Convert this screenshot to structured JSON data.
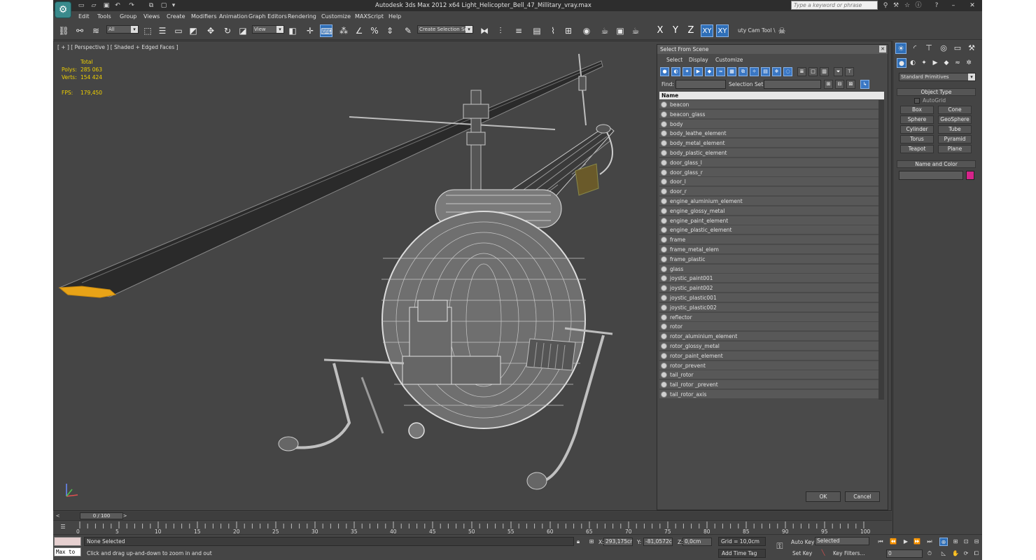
{
  "titlebar": {
    "app_title": "Autodesk 3ds Max  2012 x64     Light_Helicopter_Bell_47_Millitary_vray.max",
    "search_placeholder": "Type a keyword or phrase"
  },
  "menu": [
    "Edit",
    "Tools",
    "Group",
    "Views",
    "Create",
    "Modifiers",
    "Animation",
    "Graph Editors",
    "Rendering",
    "Customize",
    "MAXScript",
    "Help"
  ],
  "toolbar": {
    "selection_filter": "All",
    "reference_coord": "View",
    "named_selection": "Create Selection Se",
    "axis_x": "X",
    "axis_y": "Y",
    "axis_z": "Z",
    "axis_xy": "XY",
    "axis_xy2": "XY",
    "camera_tool": "uty Cam Tool \\"
  },
  "viewport": {
    "label": "[ + ] [ Perspective ] [ Shaded + Edged Faces ]",
    "stats": {
      "total_label": "Total",
      "polys_label": "Polys:",
      "polys_value": "285 063",
      "verts_label": "Verts:",
      "verts_value": "154 424",
      "fps_label": "FPS:",
      "fps_value": "179,450"
    }
  },
  "dialog": {
    "title": "Select From Scene",
    "menu": [
      "Select",
      "Display",
      "Customize"
    ],
    "find_label": "Find:",
    "selection_set_label": "Selection Set:",
    "column_name": "Name",
    "items": [
      "beacon",
      "beacon_glass",
      "body",
      "body_leathe_element",
      "body_metal_element",
      "body_plastic_element",
      "door_glass_l",
      "door_glass_r",
      "door_l",
      "door_r",
      "engine_aluminium_element",
      "engine_glossy_metal",
      "engine_paint_element",
      "engine_plastic_element",
      "frame",
      "frame_metal_elem",
      "frame_plastic",
      "glass",
      "joystic_paint001",
      "joystic_paint002",
      "joystic_plastic001",
      "joystic_plastic002",
      "reflector",
      "rotor",
      "rotor_aluminium_element",
      "rotor_glossy_metal",
      "rotor_paint_element",
      "rotor_prevent",
      "tail_rotor",
      "tail_rotor _prevent",
      "tail_rotor_axis"
    ],
    "ok_label": "OK",
    "cancel_label": "Cancel"
  },
  "command_panel": {
    "category": "Standard Primitives",
    "object_type_title": "Object Type",
    "autogrid_label": "AutoGrid",
    "primitives": [
      "Box",
      "Cone",
      "Sphere",
      "GeoSphere",
      "Cylinder",
      "Tube",
      "Torus",
      "Pyramid",
      "Teapot",
      "Plane"
    ],
    "name_color_title": "Name and Color",
    "object_color": "#d6248a"
  },
  "timeline": {
    "slider_label": "0 / 100",
    "ticks": [
      "0",
      "5",
      "10",
      "15",
      "20",
      "25",
      "30",
      "35",
      "40",
      "45",
      "50",
      "55",
      "60",
      "65",
      "70",
      "75",
      "80",
      "85",
      "90",
      "95",
      "100"
    ]
  },
  "status": {
    "maxscript_label": "Max to",
    "selection_status": "None Selected",
    "prompt": "Click and drag up-and-down to zoom in and out",
    "x_label": "X:",
    "x_value": "293,175cm",
    "y_label": "Y:",
    "y_value": "-81,0572cr",
    "z_label": "Z:",
    "z_value": "0,0cm",
    "grid": "Grid = 10,0cm",
    "auto_key": "Auto Key",
    "set_key": "Set Key",
    "key_mode": "Selected",
    "key_filters": "Key Filters...",
    "add_time_tag": "Add Time Tag",
    "frame_value": "0"
  }
}
